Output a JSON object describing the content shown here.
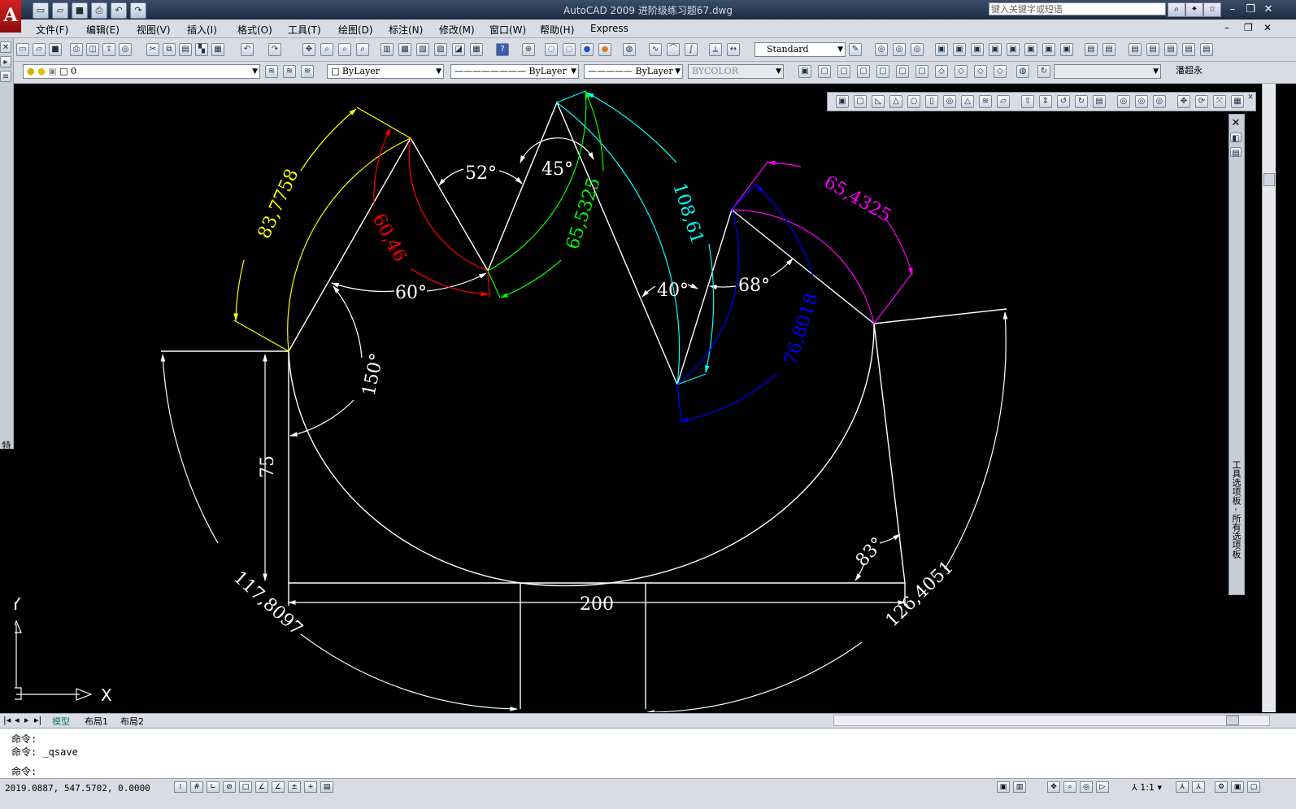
{
  "window": {
    "title": "AutoCAD 2009  进阶级练习题67.dwg",
    "search_placeholder": "键入关键字或短语",
    "logo": "A"
  },
  "menu": [
    "文件(F)",
    "编辑(E)",
    "视图(V)",
    "插入(I)",
    "格式(O)",
    "工具(T)",
    "绘图(D)",
    "标注(N)",
    "修改(M)",
    "窗口(W)",
    "帮助(H)",
    "Express"
  ],
  "toolbar": {
    "text_style": "Standard",
    "layer": "0",
    "color": "ByLayer",
    "linetype": "ByLayer",
    "lineweight": "ByLayer",
    "plot_style": "BYCOLOR",
    "user_name": "潘超永"
  },
  "side_panels": {
    "properties_label": "特性",
    "tool_palette_label": "工具选项板 - 所有选项板"
  },
  "drawing": {
    "dimensions": {
      "len_83": "83,7758",
      "len_60": "60,46",
      "len_65a": "65,5325",
      "len_108": "108,61",
      "len_65b": "65,4325",
      "len_76": "76,8018",
      "len_117": "117,8097",
      "len_126": "126,4051",
      "len_75": "75",
      "len_200": "200",
      "ang_52": "52°",
      "ang_45": "45°",
      "ang_60": "60°",
      "ang_40": "40°",
      "ang_68": "68°",
      "ang_150": "150°",
      "ang_83": "83°"
    },
    "colors": {
      "white": "#ffffff",
      "yellow": "#ffff00",
      "red": "#ff0000",
      "green": "#00ff00",
      "cyan": "#00ffff",
      "magenta": "#ff00ff",
      "blue": "#0000ff"
    },
    "ucs": {
      "y": "Y",
      "x": "X"
    }
  },
  "tabs": [
    "模型",
    "布局1",
    "布局2"
  ],
  "command": {
    "line1": "命令:",
    "line2": "命令: _qsave",
    "prompt": "命令:"
  },
  "status": {
    "coordinates": "2019.0887, 547.5702, 0.0000",
    "scale": "1:1"
  }
}
